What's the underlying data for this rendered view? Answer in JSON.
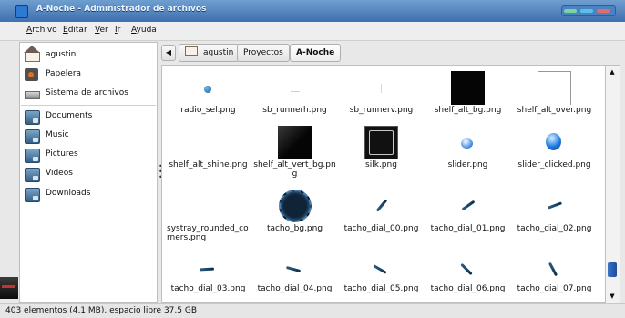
{
  "window": {
    "title": "A-Noche - Administrador de archivos"
  },
  "menu": [
    "Archivo",
    "Editar",
    "Ver",
    "Ir",
    "Ayuda"
  ],
  "sidebar": [
    {
      "label": "agustin",
      "icon": "home-icon"
    },
    {
      "label": "Papelera",
      "icon": "trash-icon"
    },
    {
      "label": "Sistema de archivos",
      "icon": "drive-icon"
    },
    {
      "label": "Documents",
      "icon": "folder-icon"
    },
    {
      "label": "Music",
      "icon": "folder-icon"
    },
    {
      "label": "Pictures",
      "icon": "folder-icon"
    },
    {
      "label": "Videos",
      "icon": "folder-icon"
    },
    {
      "label": "Downloads",
      "icon": "folder-icon"
    }
  ],
  "breadcrumb": [
    "agustin",
    "Proyectos",
    "A-Noche"
  ],
  "files": [
    "radio_sel.png",
    "sb_runnerh.png",
    "sb_runnerv.png",
    "shelf_alt_bg.png",
    "shelf_alt_over.png",
    "shelf_alt_shine.png",
    "shelf_alt_vert_bg.png",
    "silk.png",
    "slider.png",
    "slider_clicked.png",
    "systray_rounded_corners.png",
    "tacho_bg.png",
    "tacho_dial_00.png",
    "tacho_dial_01.png",
    "tacho_dial_02.png",
    "tacho_dial_03.png",
    "tacho_dial_04.png",
    "tacho_dial_05.png",
    "tacho_dial_06.png",
    "tacho_dial_07.png"
  ],
  "status": {
    "text": "403 elementos (4,1 MB), espacio libre 37,5 GB"
  },
  "colors": {
    "titlebar": "#4f82c0",
    "accent": "#2b6cb3"
  }
}
